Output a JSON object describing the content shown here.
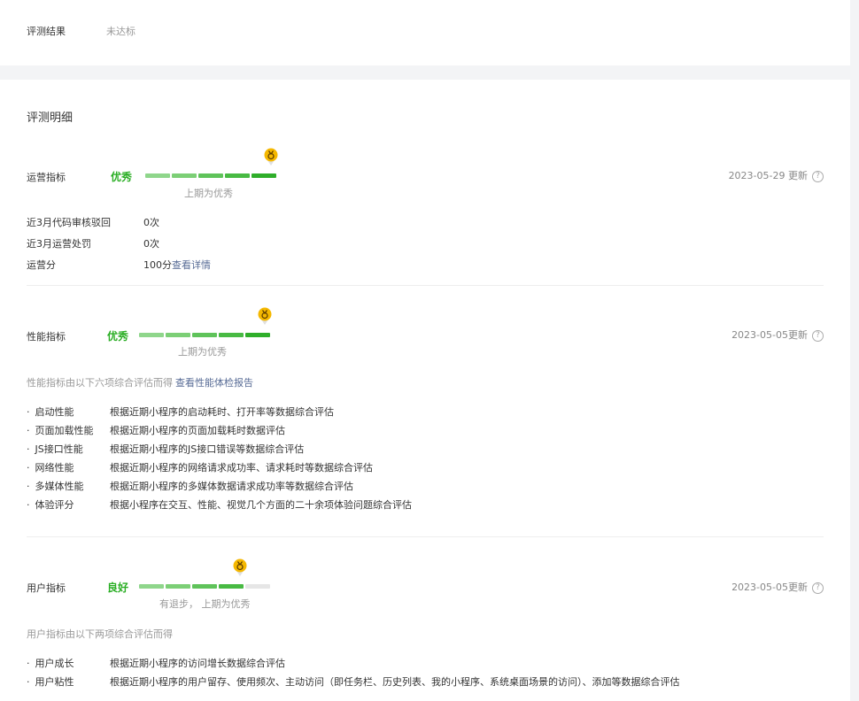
{
  "result": {
    "label": "评测结果",
    "value": "未达标"
  },
  "details_title": "评测明细",
  "operation": {
    "name": "运营指标",
    "grade": "优秀",
    "filled_segments": 5,
    "total_segments": 5,
    "previous": "上期为优秀",
    "date": "2023-05-29 更新",
    "rows": [
      {
        "label": "近3月代码审核驳回",
        "value": "0次"
      },
      {
        "label": "近3月运营处罚",
        "value": "0次"
      },
      {
        "label": "运营分",
        "value": "100分",
        "link": "查看详情"
      }
    ]
  },
  "performance": {
    "name": "性能指标",
    "grade": "优秀",
    "filled_segments": 5,
    "total_segments": 5,
    "previous": "上期为优秀",
    "date": "2023-05-05更新",
    "desc": "性能指标由以下六项综合评估而得",
    "desc_link": "查看性能体检报告",
    "items": [
      {
        "name": "启动性能",
        "desc": "根据近期小程序的启动耗时、打开率等数据综合评估"
      },
      {
        "name": "页面加载性能",
        "desc": "根据近期小程序的页面加载耗时数据评估"
      },
      {
        "name": "JS接口性能",
        "desc": "根据近期小程序的JS接口错误等数据综合评估"
      },
      {
        "name": "网络性能",
        "desc": "根据近期小程序的网络请求成功率、请求耗时等数据综合评估"
      },
      {
        "name": "多媒体性能",
        "desc": "根据近期小程序的多媒体数据请求成功率等数据综合评估"
      },
      {
        "name": "体验评分",
        "desc": "根据小程序在交互、性能、视觉几个方面的二十余项体验问题综合评估"
      }
    ]
  },
  "user": {
    "name": "用户指标",
    "grade": "良好",
    "filled_segments": 4,
    "total_segments": 5,
    "previous": "有退步， 上期为优秀",
    "date": "2023-05-05更新",
    "desc": "用户指标由以下两项综合评估而得",
    "items": [
      {
        "name": "用户成长",
        "desc": "根据近期小程序的访问增长数据综合评估"
      },
      {
        "name": "用户粘性",
        "desc": "根据近期小程序的用户留存、使用频次、主动访问（即任务栏、历史列表、我的小程序、系统桌面场景的访问）、添加等数据综合评估"
      }
    ]
  },
  "colors": {
    "green": "#2aae24",
    "link": "#576b95",
    "badge": "#f5b800"
  },
  "icons": {
    "badge": "medal-badge-icon",
    "help": "question-circle-icon"
  }
}
